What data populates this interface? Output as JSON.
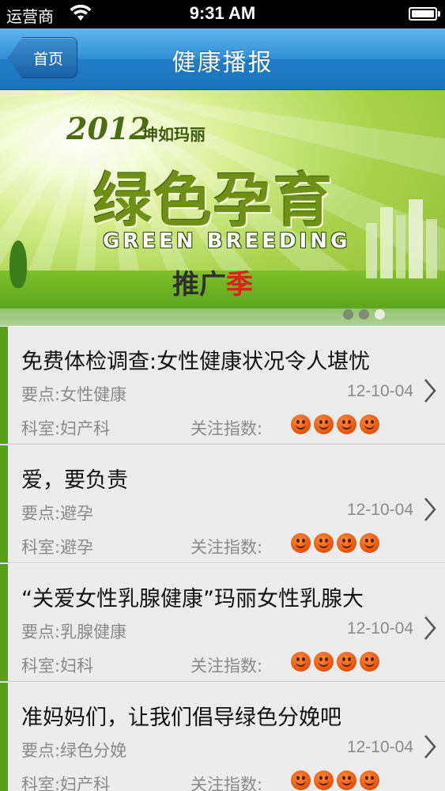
{
  "status_bar": {
    "carrier": "运营商",
    "time": "9:31 AM",
    "icons": [
      "wifi-icon",
      "battery-icon"
    ]
  },
  "nav_bar": {
    "back_label": "首页",
    "title": "健康播报",
    "accent_color": "#2f8fd6"
  },
  "banner": {
    "year": "2012",
    "brand": "坤如玛丽",
    "headline": "绿色孕育",
    "subtitle": "GREEN BREEDING",
    "promo_main": "推广",
    "promo_highlight": "季",
    "page_count": 3,
    "active_page": 3
  },
  "list": {
    "key_label": "要点:",
    "dept_label": "科室:",
    "attention_label": "关注指数:",
    "accent_color": "#55a21a",
    "items": [
      {
        "title": "免费体检调查:女性健康状况令人堪忧",
        "key_point": "女性健康",
        "date": "12-10-04",
        "department": "妇产科",
        "attention": 4
      },
      {
        "title": "爱，要负责",
        "key_point": "避孕",
        "date": "12-10-04",
        "department": "避孕",
        "attention": 4
      },
      {
        "title": "“关爱女性乳腺健康”玛丽女性乳腺大",
        "key_point": "乳腺健康",
        "date": "12-10-04",
        "department": "妇科",
        "attention": 4
      },
      {
        "title": "准妈妈们，让我们倡导绿色分娩吧",
        "key_point": "绿色分娩",
        "date": "12-10-04",
        "department": "妇产科",
        "attention": 4
      }
    ]
  }
}
